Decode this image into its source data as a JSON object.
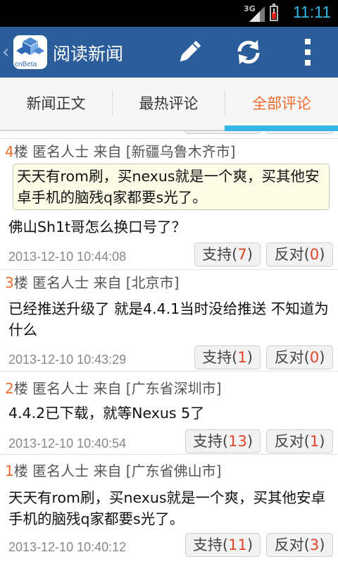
{
  "status_bar": {
    "network": "3G",
    "time": "11:11"
  },
  "header": {
    "logo_text": "cnBeta",
    "title": "阅读新闻",
    "actions": [
      "edit-icon",
      "refresh-icon",
      "overflow-menu-icon"
    ]
  },
  "tabs": [
    {
      "label": "新闻正文",
      "active": false
    },
    {
      "label": "最热评论",
      "active": false
    },
    {
      "label": "全部评论",
      "active": true
    }
  ],
  "colors": {
    "action_bar": "#2a5d99",
    "accent": "#ef6a2b",
    "tab_indicator": "#33b5e5"
  },
  "comments": [
    {
      "floor": "4",
      "author_line": "楼  匿名人士  来自 [新疆乌鲁木齐市]",
      "quote": "天天有rom刷，买nexus就是一个爽，买其他安卓手机的脑残q家都要s光了。",
      "body": "佛山Sh1t哥怎么换口号了？",
      "date": "2013-12-10 10:44:08",
      "support_label": "支持(",
      "support_count": "7",
      "oppose_label": "反对(",
      "oppose_count": "0",
      "close": ")"
    },
    {
      "floor": "3",
      "author_line": "楼  匿名人士  来自 [北京市]",
      "body": "已经推送升级了 就是4.4.1当时没给推送 不知道为什么",
      "date": "2013-12-10 10:43:29",
      "support_label": "支持(",
      "support_count": "1",
      "oppose_label": "反对(",
      "oppose_count": "0",
      "close": ")"
    },
    {
      "floor": "2",
      "author_line": "楼  匿名人士  来自 [广东省深圳市]",
      "body": "4.4.2已下载，就等Nexus 5了",
      "date": "2013-12-10 10:40:54",
      "support_label": "支持(",
      "support_count": "13",
      "oppose_label": "反对(",
      "oppose_count": "1",
      "close": ")"
    },
    {
      "floor": "1",
      "author_line": "楼  匿名人士  来自 [广东省佛山市]",
      "body": "天天有rom刷，买nexus就是一个爽，买其他安卓手机的脑残q家都要s光了。",
      "date": "2013-12-10 10:40:12",
      "support_label": "支持(",
      "support_count": "11",
      "oppose_label": "反对(",
      "oppose_count": "3",
      "close": ")"
    }
  ]
}
